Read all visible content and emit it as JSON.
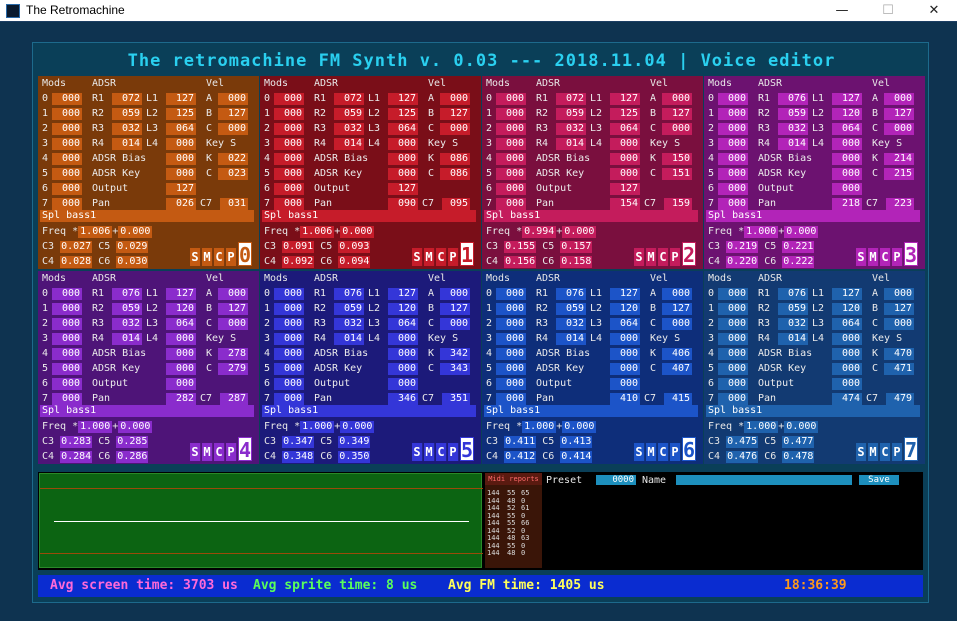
{
  "window": {
    "title": "The Retromachine",
    "min": "—",
    "max": "☐",
    "close": "✕"
  },
  "banner": "The retromachine FM Synth v. 0.03 --- 2018.11.04 | Voice editor",
  "headers": {
    "mods": "Mods",
    "adsr": "ADSR",
    "vel": "Vel"
  },
  "labels": {
    "r1": "R1",
    "r2": "R2",
    "r3": "R3",
    "r4": "R4",
    "l1": "L1",
    "l2": "L2",
    "l3": "L3",
    "l4": "L4",
    "a": "A",
    "b": "B",
    "c": "C",
    "k": "K",
    "c7": "C7",
    "keyS": "Key S",
    "adsrBias": "ADSR Bias",
    "adsrKey": "ADSR Key",
    "output": "Output",
    "pan": "Pan",
    "spl": "Spl",
    "freq": "Freq",
    "times": "*",
    "plus": "+",
    "c3": "C3",
    "c4": "C4",
    "c5": "C5",
    "c6": "C6",
    "smcp": [
      "S",
      "M",
      "C",
      "P"
    ]
  },
  "palette": [
    {
      "bg": "#7a3a0a",
      "box": "#c45a12",
      "boxtx": "#fff"
    },
    {
      "bg": "#7a0e18",
      "box": "#c61c2a",
      "boxtx": "#fff"
    },
    {
      "bg": "#7a0f3e",
      "box": "#c41c5c",
      "boxtx": "#fff"
    },
    {
      "bg": "#6c1270",
      "box": "#b224b8",
      "boxtx": "#fff"
    },
    {
      "bg": "#4e1478",
      "box": "#8a2ccc",
      "boxtx": "#fff"
    },
    {
      "bg": "#1c1a7a",
      "box": "#3436d8",
      "boxtx": "#fff"
    },
    {
      "bg": "#0e2e7a",
      "box": "#1c54c8",
      "boxtx": "#fff"
    },
    {
      "bg": "#123a72",
      "box": "#1f62ad",
      "boxtx": "#fff"
    }
  ],
  "operators": [
    {
      "num": "0",
      "mods": [
        "000",
        "000",
        "000",
        "000",
        "000",
        "000",
        "000",
        "000"
      ],
      "r": [
        "072",
        "059",
        "032",
        "014"
      ],
      "l": [
        "127",
        "125",
        "064",
        "000"
      ],
      "a": "000",
      "b": "127",
      "c": "000",
      "k": "022",
      "c_adsrkey": "023",
      "adsrBias": "000",
      "adsrKey": "000",
      "output": "127",
      "pan": "026",
      "c7": "031",
      "spl": "bass1",
      "fmul": "1.006",
      "fadd": "0.000",
      "c3": "0.027",
      "c4": "0.028",
      "c5": "0.029",
      "c6": "0.030"
    },
    {
      "num": "1",
      "mods": [
        "000",
        "000",
        "000",
        "000",
        "000",
        "000",
        "000",
        "000"
      ],
      "r": [
        "072",
        "059",
        "032",
        "014"
      ],
      "l": [
        "127",
        "125",
        "064",
        "000"
      ],
      "a": "000",
      "b": "127",
      "c": "000",
      "k": "086",
      "c_adsrkey": "086",
      "adsrBias": "000",
      "adsrKey": "000",
      "output": "127",
      "pan": "090",
      "c7": "095",
      "spl": "bass1",
      "fmul": "1.006",
      "fadd": "0.000",
      "c3": "0.091",
      "c4": "0.092",
      "c5": "0.093",
      "c6": "0.094"
    },
    {
      "num": "2",
      "mods": [
        "000",
        "000",
        "000",
        "000",
        "000",
        "000",
        "000",
        "000"
      ],
      "r": [
        "072",
        "059",
        "032",
        "014"
      ],
      "l": [
        "127",
        "125",
        "064",
        "000"
      ],
      "a": "000",
      "b": "127",
      "c": "000",
      "k": "150",
      "c_adsrkey": "151",
      "adsrBias": "000",
      "adsrKey": "000",
      "output": "127",
      "pan": "154",
      "c7": "159",
      "spl": "bass1",
      "fmul": "0.994",
      "fadd": "0.000",
      "c3": "0.155",
      "c4": "0.156",
      "c5": "0.157",
      "c6": "0.158"
    },
    {
      "num": "3",
      "mods": [
        "000",
        "000",
        "000",
        "000",
        "000",
        "000",
        "000",
        "000"
      ],
      "r": [
        "076",
        "059",
        "032",
        "014"
      ],
      "l": [
        "127",
        "120",
        "064",
        "000"
      ],
      "a": "000",
      "b": "127",
      "c": "000",
      "k": "214",
      "c_adsrkey": "215",
      "adsrBias": "000",
      "adsrKey": "000",
      "output": "000",
      "pan": "218",
      "c7": "223",
      "spl": "bass1",
      "fmul": "1.000",
      "fadd": "0.000",
      "c3": "0.219",
      "c4": "0.220",
      "c5": "0.221",
      "c6": "0.222"
    },
    {
      "num": "4",
      "mods": [
        "000",
        "000",
        "000",
        "000",
        "000",
        "000",
        "000",
        "000"
      ],
      "r": [
        "076",
        "059",
        "032",
        "014"
      ],
      "l": [
        "127",
        "120",
        "064",
        "000"
      ],
      "a": "000",
      "b": "127",
      "c": "000",
      "k": "278",
      "c_adsrkey": "279",
      "adsrBias": "000",
      "adsrKey": "000",
      "output": "000",
      "pan": "282",
      "c7": "287",
      "spl": "bass1",
      "fmul": "1.000",
      "fadd": "0.000",
      "c3": "0.283",
      "c4": "0.284",
      "c5": "0.285",
      "c6": "0.286"
    },
    {
      "num": "5",
      "mods": [
        "000",
        "000",
        "000",
        "000",
        "000",
        "000",
        "000",
        "000"
      ],
      "r": [
        "076",
        "059",
        "032",
        "014"
      ],
      "l": [
        "127",
        "120",
        "064",
        "000"
      ],
      "a": "000",
      "b": "127",
      "c": "000",
      "k": "342",
      "c_adsrkey": "343",
      "adsrBias": "000",
      "adsrKey": "000",
      "output": "000",
      "pan": "346",
      "c7": "351",
      "spl": "bass1",
      "fmul": "1.000",
      "fadd": "0.000",
      "c3": "0.347",
      "c4": "0.348",
      "c5": "0.349",
      "c6": "0.350"
    },
    {
      "num": "6",
      "mods": [
        "000",
        "000",
        "000",
        "000",
        "000",
        "000",
        "000",
        "000"
      ],
      "r": [
        "076",
        "059",
        "032",
        "014"
      ],
      "l": [
        "127",
        "120",
        "064",
        "000"
      ],
      "a": "000",
      "b": "127",
      "c": "000",
      "k": "406",
      "c_adsrkey": "407",
      "adsrBias": "000",
      "adsrKey": "000",
      "output": "000",
      "pan": "410",
      "c7": "415",
      "spl": "bass1",
      "fmul": "1.000",
      "fadd": "0.000",
      "c3": "0.411",
      "c4": "0.412",
      "c5": "0.413",
      "c6": "0.414"
    },
    {
      "num": "7",
      "mods": [
        "000",
        "000",
        "000",
        "000",
        "000",
        "000",
        "000",
        "000"
      ],
      "r": [
        "076",
        "059",
        "032",
        "014"
      ],
      "l": [
        "127",
        "120",
        "064",
        "000"
      ],
      "a": "000",
      "b": "127",
      "c": "000",
      "k": "470",
      "c_adsrkey": "471",
      "adsrBias": "000",
      "adsrKey": "000",
      "output": "000",
      "pan": "474",
      "c7": "479",
      "spl": "bass1",
      "fmul": "1.000",
      "fadd": "0.000",
      "c3": "0.475",
      "c4": "0.476",
      "c5": "0.477",
      "c6": "0.478"
    }
  ],
  "midi": {
    "title": "Midi reports",
    "rows": [
      [
        "144",
        "55",
        "65"
      ],
      [
        "144",
        "48",
        "0"
      ],
      [
        "144",
        "52",
        "61"
      ],
      [
        "144",
        "55",
        "0"
      ],
      [
        "144",
        "55",
        "66"
      ],
      [
        "144",
        "52",
        "0"
      ],
      [
        "144",
        "48",
        "63"
      ],
      [
        "144",
        "55",
        "0"
      ],
      [
        "144",
        "48",
        "0"
      ]
    ]
  },
  "preset": {
    "label": "Preset",
    "value": "0000",
    "name_label": "Name",
    "name_value": "",
    "save": "Save"
  },
  "status": {
    "screen": "Avg screen time: 3703 us",
    "sprite": "Avg sprite time: 8 us",
    "fm": "Avg FM time: 1405 us",
    "clock": "18:36:39",
    "colors": {
      "screen": "#ff6ad8",
      "sprite": "#5aff5a",
      "fm": "#ffff5a",
      "clock": "#ff9a1a"
    }
  }
}
